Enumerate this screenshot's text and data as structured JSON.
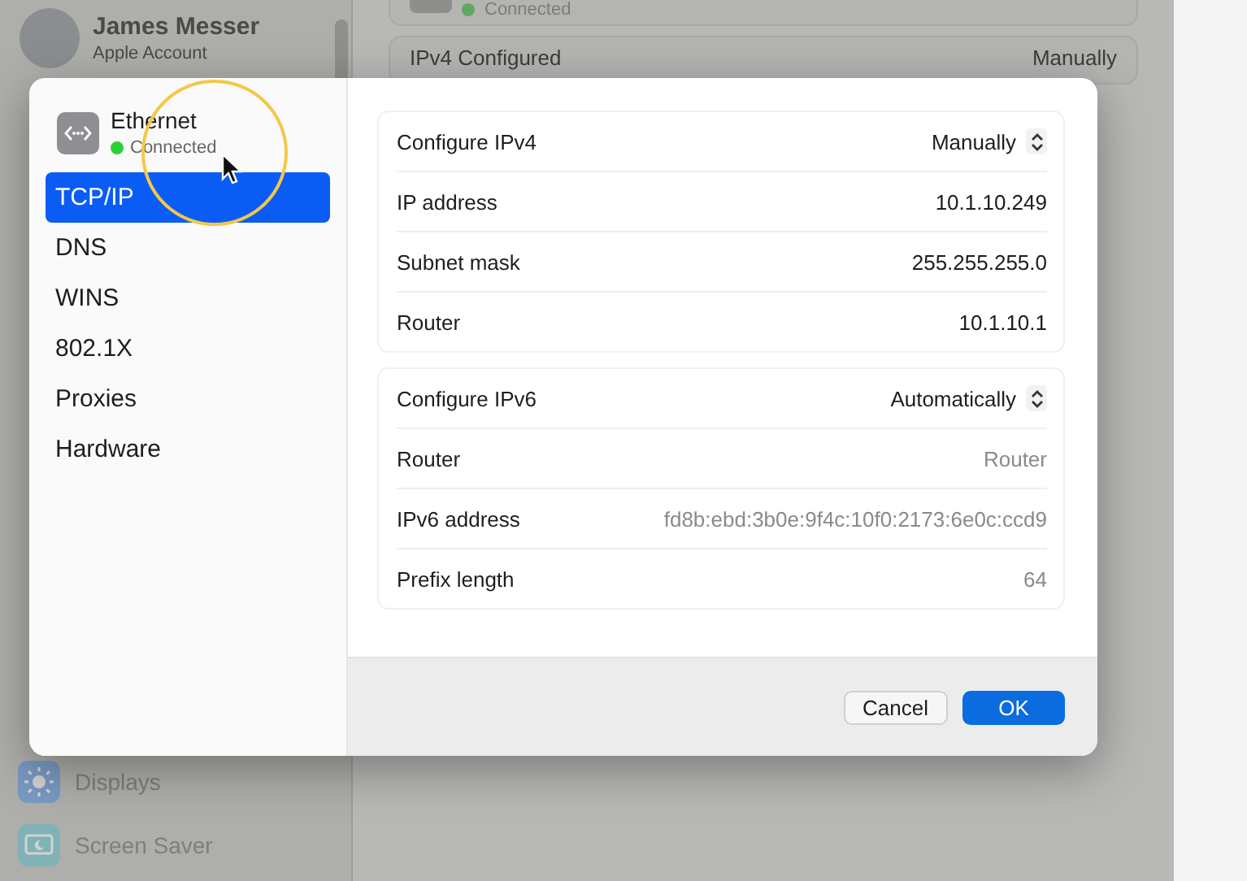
{
  "background_window": {
    "account": {
      "name": "James Messer",
      "subtitle": "Apple Account"
    },
    "sidebar_items": [
      {
        "label": "Displays",
        "kind": "displays"
      },
      {
        "label": "Screen Saver",
        "kind": "screensaver"
      }
    ],
    "status": "Connected",
    "rows": [
      {
        "label": "IPv4 Configured",
        "value": "Manually"
      }
    ]
  },
  "dialog": {
    "service": {
      "name": "Ethernet",
      "status": "Connected",
      "connected": true
    },
    "tabs": [
      {
        "label": "TCP/IP",
        "selected": true
      },
      {
        "label": "DNS",
        "selected": false
      },
      {
        "label": "WINS",
        "selected": false
      },
      {
        "label": "802.1X",
        "selected": false
      },
      {
        "label": "Proxies",
        "selected": false
      },
      {
        "label": "Hardware",
        "selected": false
      }
    ],
    "sections": [
      {
        "rows": [
          {
            "kind": "popup",
            "label": "Configure IPv4",
            "value": "Manually",
            "dimmed": false
          },
          {
            "kind": "value",
            "label": "IP address",
            "value": "10.1.10.249",
            "dimmed": false
          },
          {
            "kind": "value",
            "label": "Subnet mask",
            "value": "255.255.255.0",
            "dimmed": false
          },
          {
            "kind": "value",
            "label": "Router",
            "value": "10.1.10.1",
            "dimmed": false
          }
        ]
      },
      {
        "rows": [
          {
            "kind": "popup",
            "label": "Configure IPv6",
            "value": "Automatically",
            "dimmed": false
          },
          {
            "kind": "value",
            "label": "Router",
            "value": "Router",
            "dimmed": true
          },
          {
            "kind": "value",
            "label": "IPv6 address",
            "value": "fd8b:ebd:3b0e:9f4c:10f0:2173:6e0c:ccd9",
            "dimmed": true
          },
          {
            "kind": "value",
            "label": "Prefix length",
            "value": "64",
            "dimmed": true
          }
        ]
      }
    ],
    "buttons": [
      {
        "label": "Cancel",
        "kind": "secondary"
      },
      {
        "label": "OK",
        "kind": "primary"
      }
    ]
  }
}
